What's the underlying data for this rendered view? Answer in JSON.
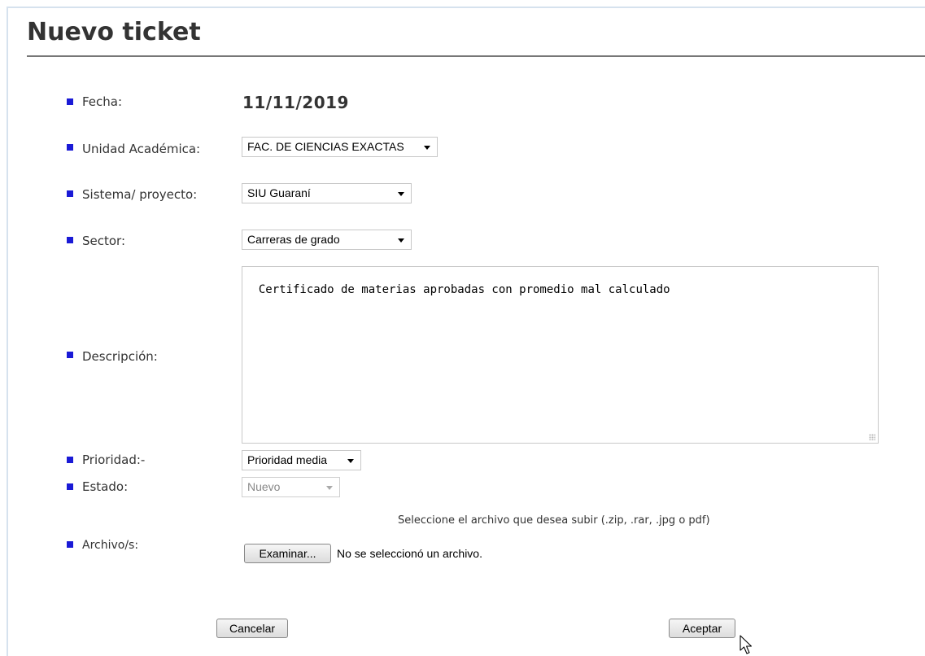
{
  "page": {
    "title": "Nuevo ticket"
  },
  "form": {
    "fecha": {
      "label": "Fecha:",
      "value": "11/11/2019"
    },
    "unidad": {
      "label": "Unidad Académica:",
      "selected": "FAC. DE CIENCIAS EXACTAS"
    },
    "sistema": {
      "label": "Sistema/ proyecto:",
      "selected": "SIU Guaraní"
    },
    "sector": {
      "label": "Sector:",
      "selected": "Carreras de grado"
    },
    "descripcion": {
      "label": "Descripción:",
      "value": "Certificado de materias aprobadas con promedio mal calculado"
    },
    "prioridad": {
      "label": "Prioridad:-",
      "selected": "Prioridad media"
    },
    "estado": {
      "label": "Estado:",
      "selected": "Nuevo"
    },
    "archivo": {
      "label": "Archivo/s:",
      "hint": "Seleccione el archivo que desea subir (.zip, .rar, .jpg o pdf)",
      "browse_label": "Examinar...",
      "status": "No se seleccionó un archivo."
    }
  },
  "actions": {
    "cancel_label": "Cancelar",
    "accept_label": "Aceptar"
  },
  "colors": {
    "bullet": "#1a1ad6",
    "title_rule": "#777777",
    "frame": "#d6e2ee"
  }
}
